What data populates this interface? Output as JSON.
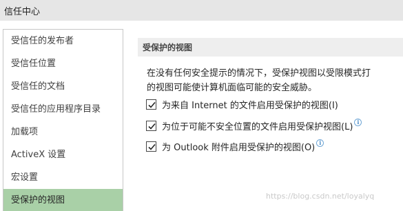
{
  "window": {
    "title": "信任中心"
  },
  "sidebar": {
    "items": [
      {
        "label": "受信任的发布者"
      },
      {
        "label": "受信任位置"
      },
      {
        "label": "受信任的文档"
      },
      {
        "label": "受信任的应用程序目录"
      },
      {
        "label": "加载项"
      },
      {
        "label": "ActiveX 设置"
      },
      {
        "label": "宏设置"
      },
      {
        "label": "受保护的视图",
        "selected": true
      }
    ]
  },
  "main": {
    "section_title": "受保护的视图",
    "description_line1": "在没有任何安全提示的情况下，受保护视图以受限模式打",
    "description_line2": "的视图可能使计算机面临可能的安全威胁。",
    "options": [
      {
        "label": "为来自 Internet 的文件启用受保护的视图(I)",
        "checked": true,
        "info_icon": false
      },
      {
        "label": "为位于可能不安全位置的文件启用受保护视图(L)",
        "checked": true,
        "info_icon": true
      },
      {
        "label": "为 Outlook 附件启用受保护的视图(O)",
        "checked": true,
        "info_icon": true
      }
    ]
  },
  "watermark": "https://blog.csdn.net/loyalyq",
  "colors": {
    "titlebar_bg": "#e6e6e6",
    "selected_bg": "#a9d0a7",
    "section_header_bg": "#eeeeee",
    "info_icon": "#4a8cc7"
  }
}
